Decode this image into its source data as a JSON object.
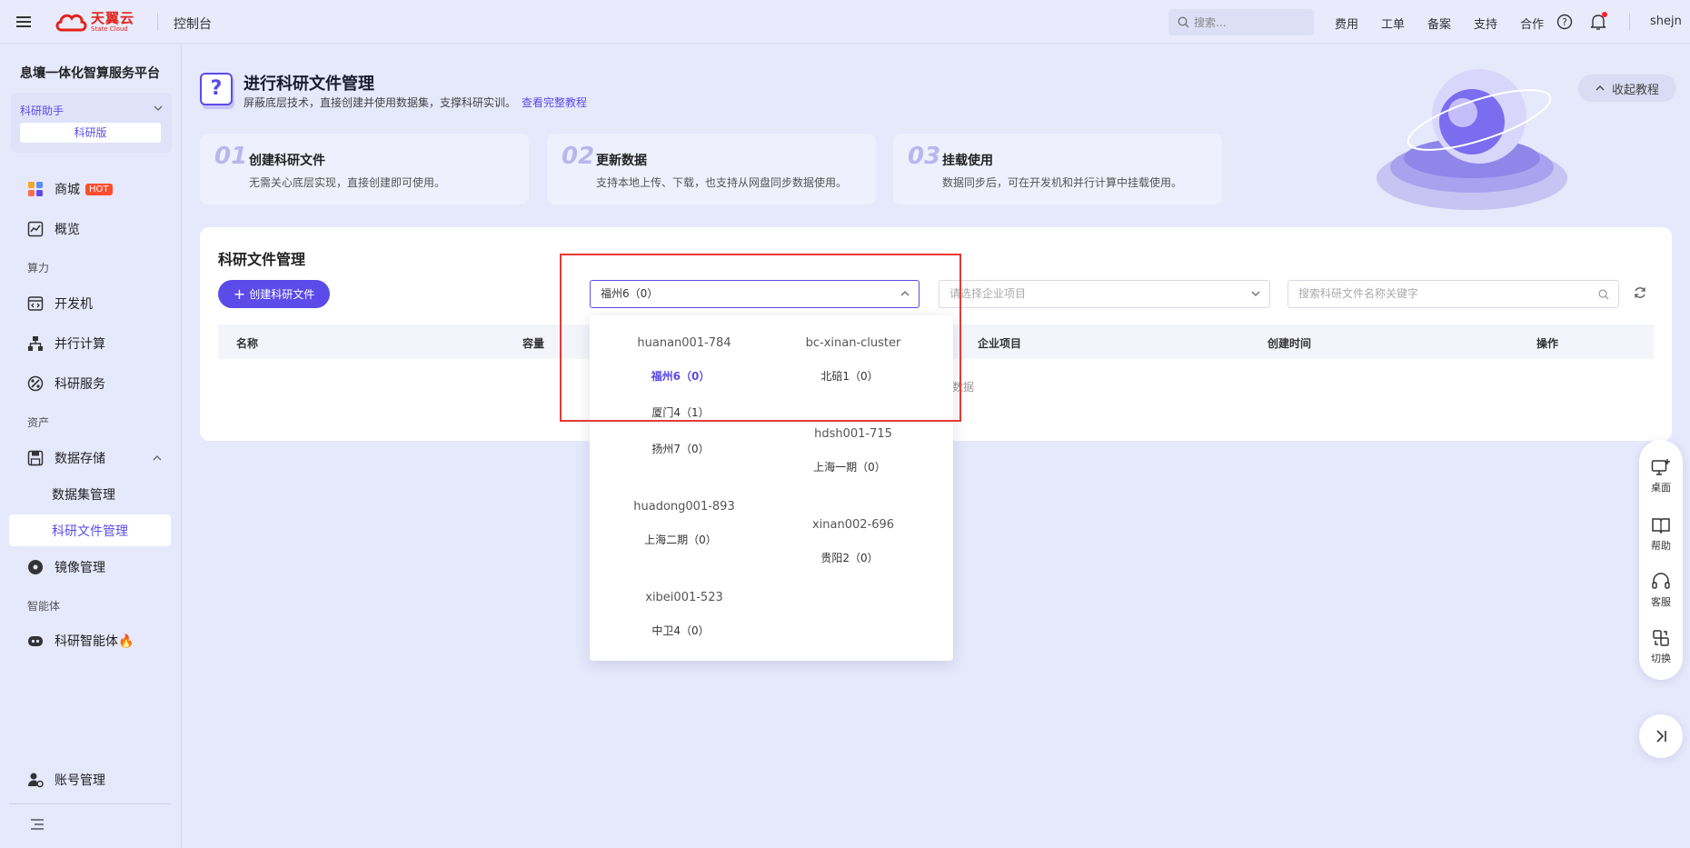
{
  "topbar": {
    "logo_cn": "天翼云",
    "logo_en": "State Cloud",
    "console": "控制台",
    "search_placeholder": "搜索...",
    "nav": [
      "费用",
      "工单",
      "备案",
      "支持",
      "合作"
    ],
    "username": "shejn"
  },
  "sidebar": {
    "platform": "息壤一体化智算服务平台",
    "assistant": "科研助手",
    "edition": "科研版",
    "mall": "商城",
    "hot": "HOT",
    "overview": "概览",
    "section_compute": "算力",
    "devbox": "开发机",
    "parallel": "并行计算",
    "research_service": "科研服务",
    "section_assets": "资产",
    "storage": "数据存储",
    "dataset_mgmt": "数据集管理",
    "file_mgmt": "科研文件管理",
    "image_mgmt": "镜像管理",
    "section_agent": "智能体",
    "agent": "科研智能体🔥",
    "account": "账号管理"
  },
  "banner": {
    "title": "进行科研文件管理",
    "subtitle": "屏蔽底层技术，直接创建并使用数据集，支撑科研实训。",
    "link": "查看完整教程",
    "collapse": "收起教程"
  },
  "steps": [
    {
      "num": "01",
      "title": "创建科研文件",
      "desc": "无需关心底层实现，直接创建即可使用。"
    },
    {
      "num": "02",
      "title": "更新数据",
      "desc": "支持本地上传、下载，也支持从网盘同步数据使用。"
    },
    {
      "num": "03",
      "title": "挂载使用",
      "desc": "数据同步后，可在开发机和并行计算中挂载使用。"
    }
  ],
  "panel": {
    "title": "科研文件管理",
    "create_btn": "创建科研文件",
    "region_value": "福州6（0）",
    "project_placeholder": "请选择企业项目",
    "keyword_placeholder": "搜索科研文件名称关键字",
    "columns": [
      "名称",
      "容量",
      "企业项目",
      "创建时间",
      "操作"
    ],
    "nodata": "数据"
  },
  "dropdown": {
    "groups": [
      {
        "cluster": "huanan001-784",
        "regions": [
          "福州6（0）",
          "厦门4（1）",
          "扬州7（0）"
        ]
      },
      {
        "cluster": "bc-xinan-cluster",
        "regions": [
          "北碚1（0）"
        ]
      },
      {
        "cluster": "hdsh001-715",
        "regions": [
          "上海一期（0）"
        ]
      },
      {
        "cluster": "huadong001-893",
        "regions": [
          "上海二期（0）"
        ]
      },
      {
        "cluster": "xinan002-696",
        "regions": [
          "贵阳2（0）"
        ]
      },
      {
        "cluster": "xibei001-523",
        "regions": [
          "中卫4（0）"
        ]
      }
    ],
    "selected": "福州6（0）"
  },
  "floatbar": [
    "桌面",
    "帮助",
    "客服",
    "切换"
  ],
  "colors": {
    "accent": "#5b4be8",
    "highlight": "#e53935",
    "hot": "#ff4d2e"
  }
}
